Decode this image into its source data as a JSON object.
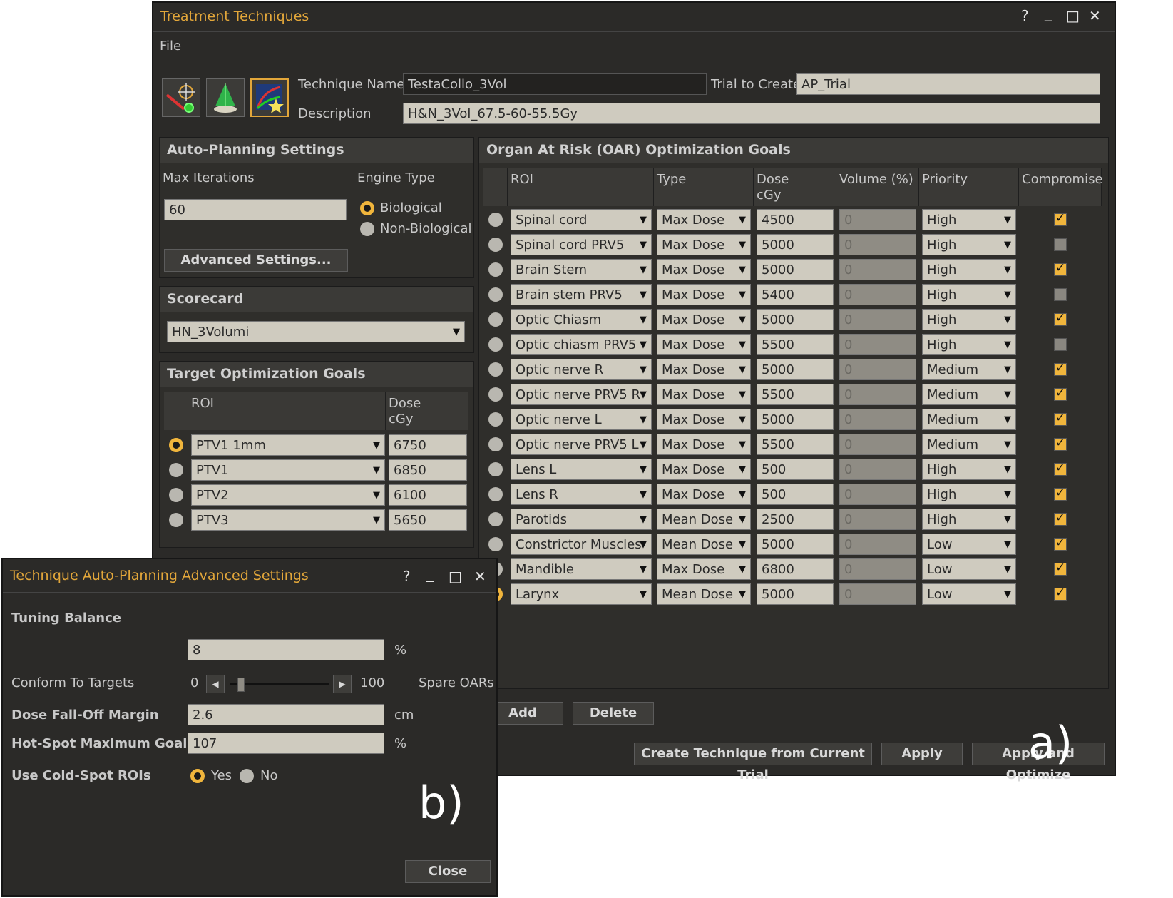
{
  "main_window": {
    "title": "Treatment Techniques",
    "controls": [
      "?",
      "_",
      "□",
      "✕"
    ],
    "menu": [
      "File"
    ],
    "technique_name_label": "Technique Name",
    "technique_name": "TestaCollo_3Vol",
    "trial_label": "Trial to Create",
    "trial": "AP_Trial",
    "description_label": "Description",
    "description": "H&N_3Vol_67.5-60-55.5Gy",
    "auto_planning": {
      "header": "Auto-Planning Settings",
      "max_iter_label": "Max Iterations",
      "max_iter": "60",
      "engine_label": "Engine Type",
      "engine_options": [
        "Biological",
        "Non-Biological"
      ],
      "engine_selected": 0,
      "advanced_button": "Advanced Settings..."
    },
    "scorecard": {
      "header": "Scorecard",
      "value": "HN_3Volumi"
    },
    "target_goals": {
      "header": "Target Optimization Goals",
      "col_roi": "ROI",
      "col_dose": "Dose\ncGy",
      "rows": [
        {
          "roi": "PTV1 1mm",
          "dose": "6750",
          "selected": true
        },
        {
          "roi": "PTV1",
          "dose": "6850",
          "selected": false
        },
        {
          "roi": "PTV2",
          "dose": "6100",
          "selected": false
        },
        {
          "roi": "PTV3",
          "dose": "5650",
          "selected": false
        }
      ]
    },
    "oar_goals": {
      "header": "Organ At Risk (OAR) Optimization Goals",
      "columns": [
        "ROI",
        "Type",
        "Dose\ncGy",
        "Volume (%)",
        "Priority",
        "Compromise"
      ],
      "rows": [
        {
          "roi": "Spinal cord",
          "type": "Max Dose",
          "dose": "4500",
          "volume": "0",
          "priority": "High",
          "compromise": true,
          "selected": false
        },
        {
          "roi": "Spinal cord PRV5",
          "type": "Max Dose",
          "dose": "5000",
          "volume": "0",
          "priority": "High",
          "compromise": false,
          "selected": false
        },
        {
          "roi": "Brain Stem",
          "type": "Max Dose",
          "dose": "5000",
          "volume": "0",
          "priority": "High",
          "compromise": true,
          "selected": false
        },
        {
          "roi": "Brain stem PRV5",
          "type": "Max Dose",
          "dose": "5400",
          "volume": "0",
          "priority": "High",
          "compromise": false,
          "selected": false
        },
        {
          "roi": "Optic Chiasm",
          "type": "Max Dose",
          "dose": "5000",
          "volume": "0",
          "priority": "High",
          "compromise": true,
          "selected": false
        },
        {
          "roi": "Optic chiasm PRV5",
          "type": "Max Dose",
          "dose": "5500",
          "volume": "0",
          "priority": "High",
          "compromise": false,
          "selected": false
        },
        {
          "roi": "Optic nerve R",
          "type": "Max Dose",
          "dose": "5000",
          "volume": "0",
          "priority": "Medium",
          "compromise": true,
          "selected": false
        },
        {
          "roi": "Optic nerve PRV5 R",
          "type": "Max Dose",
          "dose": "5500",
          "volume": "0",
          "priority": "Medium",
          "compromise": true,
          "selected": false
        },
        {
          "roi": "Optic nerve L",
          "type": "Max Dose",
          "dose": "5000",
          "volume": "0",
          "priority": "Medium",
          "compromise": true,
          "selected": false
        },
        {
          "roi": "Optic nerve PRV5 L",
          "type": "Max Dose",
          "dose": "5500",
          "volume": "0",
          "priority": "Medium",
          "compromise": true,
          "selected": false
        },
        {
          "roi": "Lens L",
          "type": "Max Dose",
          "dose": "500",
          "volume": "0",
          "priority": "High",
          "compromise": true,
          "selected": false
        },
        {
          "roi": "Lens R",
          "type": "Max Dose",
          "dose": "500",
          "volume": "0",
          "priority": "High",
          "compromise": true,
          "selected": false
        },
        {
          "roi": "Parotids",
          "type": "Mean Dose",
          "dose": "2500",
          "volume": "0",
          "priority": "High",
          "compromise": true,
          "selected": false
        },
        {
          "roi": "Constrictor Muscles",
          "type": "Mean Dose",
          "dose": "5000",
          "volume": "0",
          "priority": "Low",
          "compromise": true,
          "selected": false
        },
        {
          "roi": "Mandible",
          "type": "Max Dose",
          "dose": "6800",
          "volume": "0",
          "priority": "Low",
          "compromise": true,
          "selected": false
        },
        {
          "roi": "Larynx",
          "type": "Mean Dose",
          "dose": "5000",
          "volume": "0",
          "priority": "Low",
          "compromise": true,
          "selected": true
        }
      ]
    },
    "add_button": "Add",
    "delete_button": "Delete",
    "create_button": "Create Technique from Current Trial",
    "apply_button": "Apply",
    "apply_optimize_button": "Apply and Optimize",
    "annotation": "a)"
  },
  "advanced_window": {
    "title": "Technique Auto-Planning Advanced Settings",
    "controls": [
      "?",
      "_",
      "□",
      "✕"
    ],
    "tuning_label": "Tuning Balance",
    "tuning_value": "8",
    "tuning_unit": "%",
    "conform_label": "Conform To Targets",
    "slider_min": "0",
    "slider_max": "100",
    "slider_value": 8,
    "spare_label": "Spare OARs",
    "falloff_label": "Dose Fall-Off Margin",
    "falloff_value": "2.6",
    "falloff_unit": "cm",
    "hotspot_label": "Hot-Spot Maximum Goal",
    "hotspot_value": "107",
    "hotspot_unit": "%",
    "coldspot_label": "Use Cold-Spot ROIs",
    "coldspot_yes": "Yes",
    "coldspot_no": "No",
    "coldspot_selected": "Yes",
    "close_button": "Close",
    "annotation": "b)"
  },
  "colors": {
    "accent": "#f0b53c",
    "title": "#e3a73a",
    "background": "#2b2a28",
    "field": "#cfcbbf"
  }
}
